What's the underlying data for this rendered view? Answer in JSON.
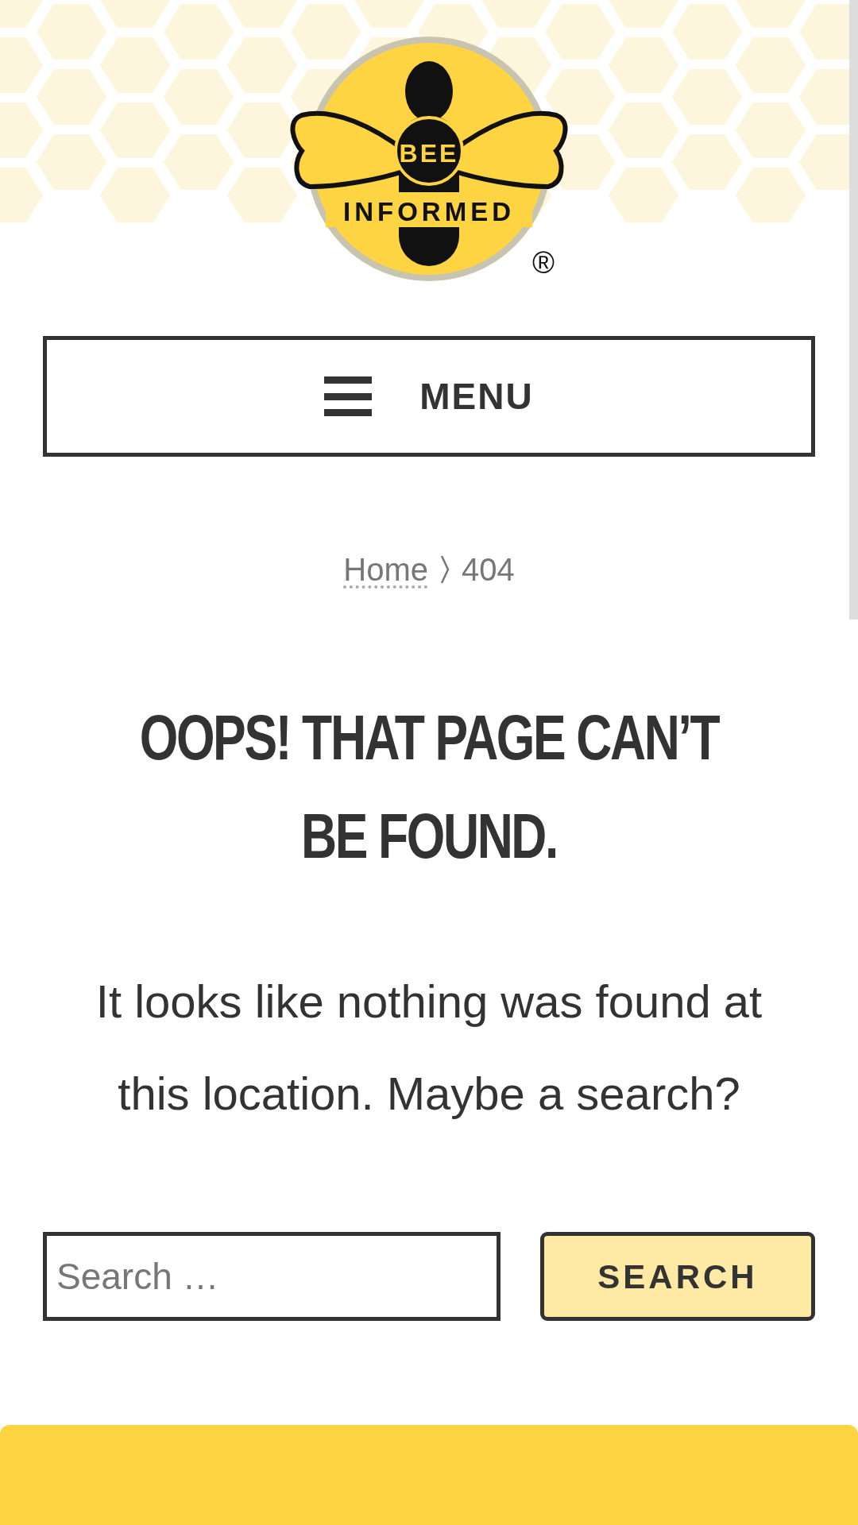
{
  "logo": {
    "top_text": "BEE",
    "bottom_text": "INFORMED",
    "mark": "®"
  },
  "menu_button": {
    "label": "MENU"
  },
  "breadcrumb": [
    {
      "label": "Home",
      "current": false
    },
    {
      "label": "404",
      "current": true
    }
  ],
  "heading": "OOPS! THAT PAGE CAN’T BE FOUND.",
  "message": "It looks like nothing was found at this location. Maybe a search?",
  "search": {
    "placeholder": "Search …",
    "button": "SEARCH"
  }
}
